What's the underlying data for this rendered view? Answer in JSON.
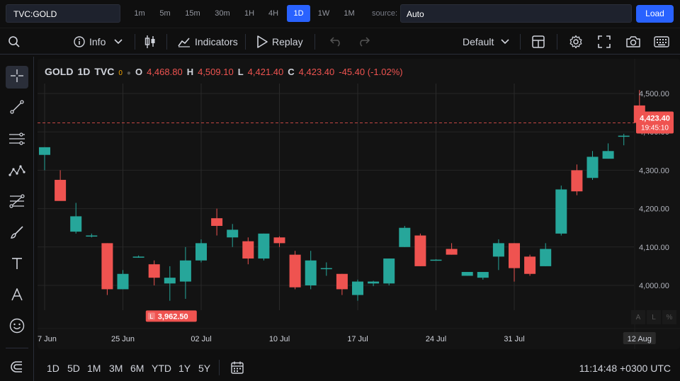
{
  "topbar": {
    "symbol": "TVC:GOLD",
    "intervals": [
      "1m",
      "5m",
      "15m",
      "30m",
      "1H",
      "4H",
      "1D",
      "1W",
      "1M"
    ],
    "active_interval": "1D",
    "source_label": "source:",
    "source_value": "Auto",
    "load_label": "Load"
  },
  "toolbar": {
    "info_label": "Info",
    "indicators_label": "Indicators",
    "replay_label": "Replay",
    "layout_label": "Default"
  },
  "legend": {
    "symbol": "GOLD",
    "interval": "1D",
    "exchange": "TVC",
    "dot_value": "0",
    "o_label": "O",
    "o_value": "4,468.80",
    "h_label": "H",
    "h_value": "4,509.10",
    "l_label": "L",
    "l_value": "4,421.40",
    "c_label": "C",
    "c_value": "4,423.40",
    "change": "-45.40 (-1.02%)"
  },
  "price_tag": {
    "price": "4,423.40",
    "countdown": "19:45:10"
  },
  "low_marker": {
    "label": "L",
    "value": "3,962.50"
  },
  "scale_buttons": [
    "A",
    "L",
    "%"
  ],
  "bottom": {
    "ranges": [
      "1D",
      "5D",
      "1M",
      "3M",
      "6M",
      "YTD",
      "1Y",
      "5Y"
    ],
    "clock": "11:14:48 +0300 UTC"
  },
  "colors": {
    "up": "#26a69a",
    "down": "#ef5350",
    "accent": "#2962ff"
  },
  "chart_data": {
    "type": "candlestick",
    "title": "",
    "ylim": [
      3880,
      4580
    ],
    "yticks": [
      4000,
      4100,
      4200,
      4300,
      4400,
      4500
    ],
    "ytick_labels": [
      "4,000.00",
      "4,100.00",
      "4,200.00",
      "4,300.00",
      "4,400.00",
      "4,500.00"
    ],
    "xtick_labels": [
      "7 Jun",
      "25 Jun",
      "02 Jul",
      "10 Jul",
      "17 Jul",
      "24 Jul",
      "31 Jul",
      "12 Aug"
    ],
    "xtick_bar_index": [
      0,
      5,
      10,
      15,
      20,
      25,
      30,
      38
    ],
    "last_price": 4423.4,
    "candles": [
      {
        "o": 4340,
        "h": 4360,
        "l": 4300,
        "c": 4360
      },
      {
        "o": 4275,
        "h": 4300,
        "l": 4225,
        "c": 4220
      },
      {
        "o": 4140,
        "h": 4215,
        "l": 4135,
        "c": 4180
      },
      {
        "o": 4130,
        "h": 4135,
        "l": 4125,
        "c": 4130
      },
      {
        "o": 4110,
        "h": 4110,
        "l": 3975,
        "c": 3990
      },
      {
        "o": 3990,
        "h": 4040,
        "l": 3990,
        "c": 4030
      },
      {
        "o": 4075,
        "h": 4078,
        "l": 4072,
        "c": 4075
      },
      {
        "o": 4055,
        "h": 4065,
        "l": 4000,
        "c": 4020
      },
      {
        "o": 4005,
        "h": 4050,
        "l": 3960,
        "c": 4020
      },
      {
        "o": 4010,
        "h": 4100,
        "l": 3965,
        "c": 4065
      },
      {
        "o": 4065,
        "h": 4120,
        "l": 4060,
        "c": 4110
      },
      {
        "o": 4175,
        "h": 4200,
        "l": 4130,
        "c": 4155
      },
      {
        "o": 4125,
        "h": 4160,
        "l": 4100,
        "c": 4145
      },
      {
        "o": 4115,
        "h": 4125,
        "l": 4055,
        "c": 4070
      },
      {
        "o": 4070,
        "h": 4135,
        "l": 4065,
        "c": 4135
      },
      {
        "o": 4125,
        "h": 4128,
        "l": 4100,
        "c": 4110
      },
      {
        "o": 4080,
        "h": 4090,
        "l": 3990,
        "c": 3995
      },
      {
        "o": 4000,
        "h": 4090,
        "l": 3990,
        "c": 4065
      },
      {
        "o": 4045,
        "h": 4060,
        "l": 4025,
        "c": 4045
      },
      {
        "o": 4030,
        "h": 4030,
        "l": 3975,
        "c": 3990
      },
      {
        "o": 3975,
        "h": 4015,
        "l": 3960,
        "c": 4010
      },
      {
        "o": 4005,
        "h": 4012,
        "l": 3998,
        "c": 4010
      },
      {
        "o": 4005,
        "h": 4070,
        "l": 4000,
        "c": 4070
      },
      {
        "o": 4100,
        "h": 4155,
        "l": 4100,
        "c": 4150
      },
      {
        "o": 4130,
        "h": 4135,
        "l": 4050,
        "c": 4050
      },
      {
        "o": 4067,
        "h": 4068,
        "l": 4065,
        "c": 4067
      },
      {
        "o": 4095,
        "h": 4110,
        "l": 4080,
        "c": 4080
      },
      {
        "o": 4025,
        "h": 4035,
        "l": 4025,
        "c": 4035
      },
      {
        "o": 4020,
        "h": 4035,
        "l": 4015,
        "c": 4035
      },
      {
        "o": 4075,
        "h": 4120,
        "l": 4040,
        "c": 4110
      },
      {
        "o": 4110,
        "h": 4110,
        "l": 4010,
        "c": 4045
      },
      {
        "o": 4075,
        "h": 4080,
        "l": 4025,
        "c": 4030
      },
      {
        "o": 4050,
        "h": 4110,
        "l": 4050,
        "c": 4095
      },
      {
        "o": 4135,
        "h": 4260,
        "l": 4130,
        "c": 4250
      },
      {
        "o": 4300,
        "h": 4315,
        "l": 4235,
        "c": 4245
      },
      {
        "o": 4280,
        "h": 4350,
        "l": 4275,
        "c": 4335
      },
      {
        "o": 4330,
        "h": 4370,
        "l": 4330,
        "c": 4350
      },
      {
        "o": 4390,
        "h": 4395,
        "l": 4365,
        "c": 4390
      },
      {
        "o": 4468.8,
        "h": 4509.1,
        "l": 4421.4,
        "c": 4423.4
      }
    ]
  }
}
